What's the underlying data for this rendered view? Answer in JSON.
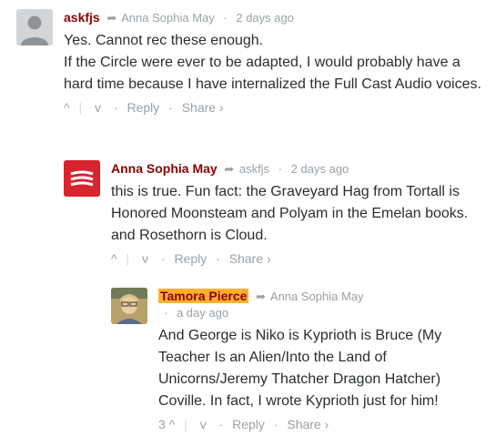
{
  "comments": [
    {
      "author": "askfjs",
      "reply_to": "Anna Sophia May",
      "time": "2 days ago",
      "paragraphs": [
        "Yes. Cannot rec these enough.",
        "If the Circle were ever to be adapted, I would probably have a hard time because I have internalized the Full Cast Audio voices."
      ],
      "votes": "",
      "reply_label": "Reply",
      "share_label": "Share ›"
    },
    {
      "author": "Anna Sophia May",
      "reply_to": "askfjs",
      "time": "2 days ago",
      "paragraphs": [
        "this is true. Fun fact: the Graveyard Hag from Tortall is Honored Moonsteam and Polyam in the Emelan books. and Rosethorn is Cloud."
      ],
      "votes": "",
      "reply_label": "Reply",
      "share_label": "Share ›"
    },
    {
      "author": "Tamora Pierce",
      "reply_to": "Anna Sophia May",
      "time": "a day ago",
      "paragraphs": [
        "And George is Niko is Kyprioth is Bruce (My Teacher Is an Alien/Into the Land of Unicorns/Jeremy Thatcher Dragon Hatcher) Coville. In fact, I wrote Kyprioth just for him!"
      ],
      "votes": "3",
      "reply_label": "Reply",
      "share_label": "Share ›"
    }
  ],
  "icons": {
    "reply_arrow": "reply-arrow-icon",
    "upvote": "upvote-icon",
    "downvote": "downvote-icon"
  },
  "colors": {
    "author": "#8b0000",
    "highlight": "#ffb02e",
    "meta": "#9aa1a6"
  }
}
